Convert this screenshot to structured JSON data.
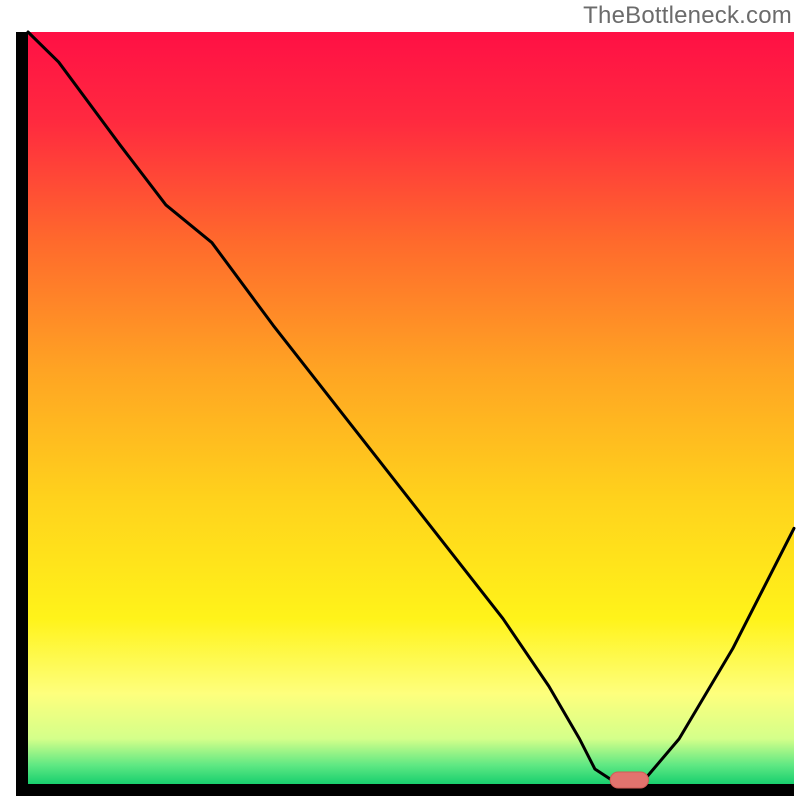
{
  "watermark": "TheBottleneck.com",
  "colors": {
    "gradient_stops": [
      {
        "offset": 0.0,
        "color": "#FF1045"
      },
      {
        "offset": 0.12,
        "color": "#FF2A3F"
      },
      {
        "offset": 0.28,
        "color": "#FF6A2C"
      },
      {
        "offset": 0.45,
        "color": "#FFA423"
      },
      {
        "offset": 0.62,
        "color": "#FFD21C"
      },
      {
        "offset": 0.78,
        "color": "#FFF31A"
      },
      {
        "offset": 0.88,
        "color": "#FEFF7D"
      },
      {
        "offset": 0.94,
        "color": "#D4FF8A"
      },
      {
        "offset": 0.975,
        "color": "#5FE883"
      },
      {
        "offset": 1.0,
        "color": "#18CF6E"
      }
    ],
    "curve": "#000000",
    "axis": "#000000",
    "marker_fill": "#E2736E",
    "marker_stroke": "#D35B56"
  },
  "chart_data": {
    "type": "line",
    "title": "",
    "xlabel": "",
    "ylabel": "",
    "xlim": [
      0,
      100
    ],
    "ylim": [
      0,
      100
    ],
    "grid": false,
    "series": [
      {
        "name": "bottleneck-curve",
        "x": [
          0,
          4,
          12,
          18,
          24,
          32,
          42,
          52,
          62,
          68,
          72,
          74,
          77,
          80,
          85,
          92,
          100
        ],
        "y": [
          100,
          96,
          85,
          77,
          72,
          61,
          48,
          35,
          22,
          13,
          6,
          2,
          0,
          0,
          6,
          18,
          34
        ]
      }
    ],
    "marker": {
      "name": "optimal-point",
      "x_center": 78.5,
      "y": 0,
      "width": 5,
      "height": 3
    },
    "legend": null
  }
}
